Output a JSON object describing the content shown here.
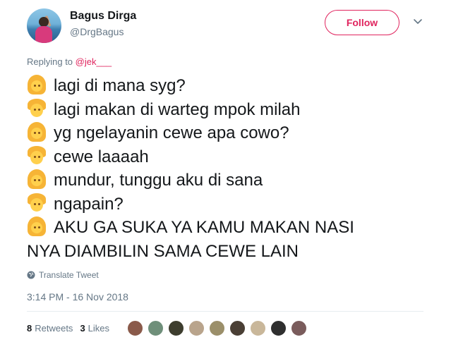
{
  "user": {
    "display_name": "Bagus Dirga",
    "handle": "@DrgBagus"
  },
  "follow_button": {
    "label": "Follow"
  },
  "reply": {
    "prefix": "Replying to ",
    "mention": "@jek___"
  },
  "tweet": {
    "lines": [
      {
        "emoji": "girl-emoji",
        "text": "lagi di mana syg?"
      },
      {
        "emoji": "boy-emoji",
        "text": "lagi makan di warteg mpok milah"
      },
      {
        "emoji": "girl-emoji",
        "text": "yg ngelayanin cewe apa cowo?"
      },
      {
        "emoji": "boy-emoji",
        "text": "cewe laaaah"
      },
      {
        "emoji": "girl-emoji",
        "text": "mundur, tunggu aku di sana"
      },
      {
        "emoji": "boy-emoji",
        "text": "ngapain?"
      },
      {
        "emoji": "girl-emoji",
        "text": "AKU GA SUKA YA KAMU MAKAN NASI"
      },
      {
        "emoji": null,
        "text": "NYA DIAMBILIN SAMA CEWE LAIN"
      }
    ]
  },
  "translate": {
    "label": "Translate Tweet",
    "icon": "globe-icon"
  },
  "timestamp": "3:14 PM - 16 Nov 2018",
  "stats": {
    "retweets_count": "8",
    "retweets_label": "Retweets",
    "likes_count": "3",
    "likes_label": "Likes"
  },
  "likers": [
    {
      "color": "#8a5a4a"
    },
    {
      "color": "#6f8f7a"
    },
    {
      "color": "#3d3d2e"
    },
    {
      "color": "#b9a48c"
    },
    {
      "color": "#9b8f6a"
    },
    {
      "color": "#4a3f35"
    },
    {
      "color": "#c9b79a"
    },
    {
      "color": "#2f2f2f"
    },
    {
      "color": "#7a5c5c"
    }
  ],
  "colors": {
    "accent": "#e0245e",
    "text_primary": "#14171a",
    "text_secondary": "#657786",
    "divider": "#e6ecf0"
  }
}
